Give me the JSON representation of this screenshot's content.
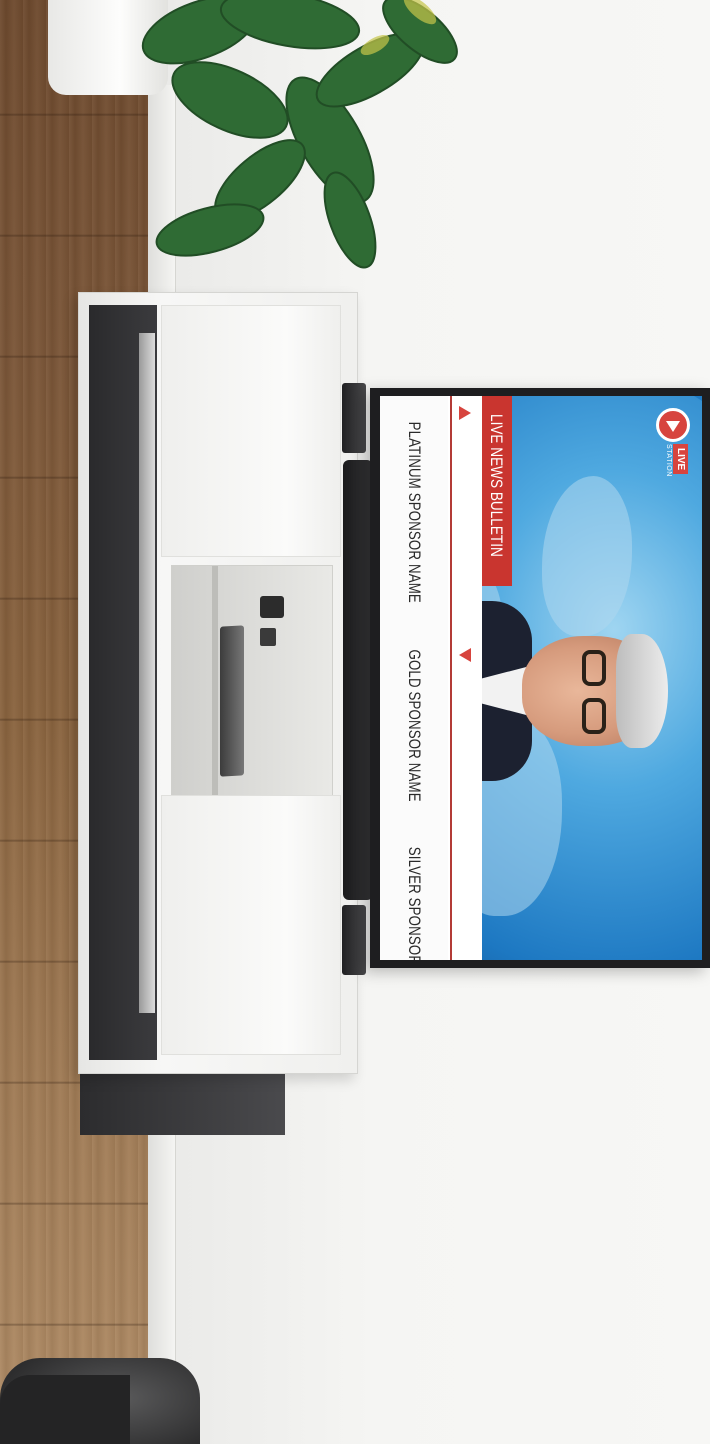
{
  "scene": {
    "description_free": true
  },
  "tv": {
    "logo": {
      "primary": "LIVE",
      "secondary": "STATION"
    },
    "bulletin_label": "LIVE NEWS BULLETIN",
    "sponsors": [
      "PLATINUM SPONSOR NAME",
      "GOLD SPONSOR NAME",
      "SILVER SPONSOR NAME"
    ]
  },
  "colors": {
    "accent_red": "#c9352f",
    "screen_blue": "#1f7bc4",
    "wall": "#f5f5f3",
    "floor": "#8a643f",
    "console": "#f2f2f0"
  }
}
